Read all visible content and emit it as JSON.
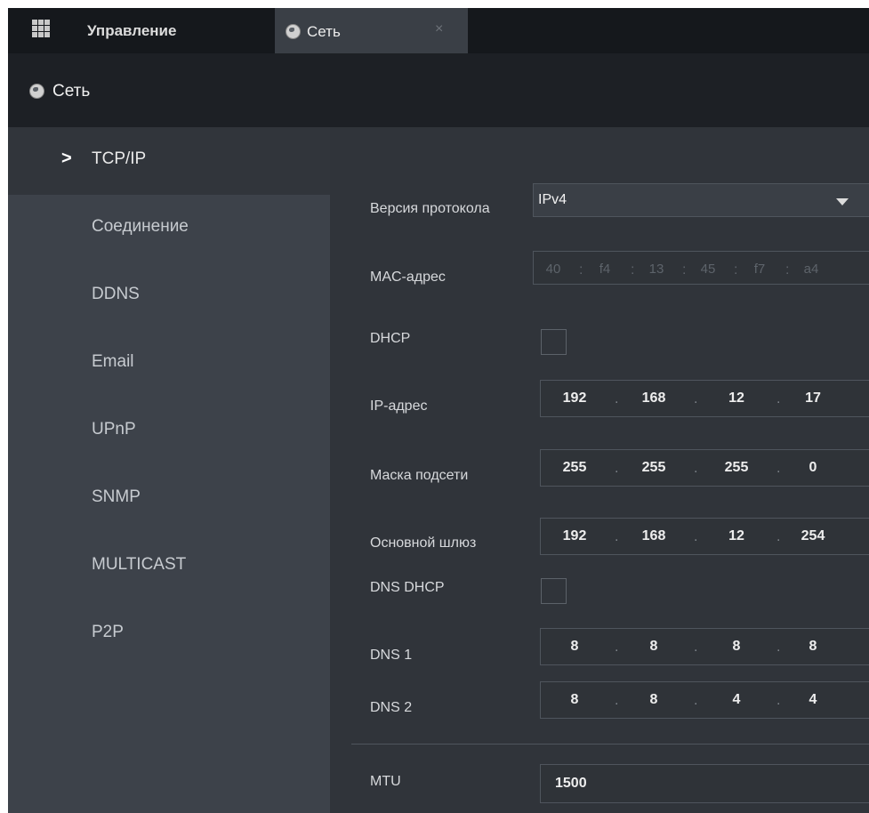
{
  "tabs": {
    "home_label": "Управление",
    "network_label": "Сеть",
    "close_glyph": "×"
  },
  "section": {
    "title": "Сеть"
  },
  "sidebar": {
    "items": [
      {
        "label": "TCP/IP",
        "active": true
      },
      {
        "label": "Соединение"
      },
      {
        "label": "DDNS"
      },
      {
        "label": "Email"
      },
      {
        "label": "UPnP"
      },
      {
        "label": "SNMP"
      },
      {
        "label": "MULTICAST"
      },
      {
        "label": "P2P"
      }
    ],
    "active_marker": ">"
  },
  "form": {
    "protocol_version": {
      "label": "Версия протокола",
      "value": "IPv4"
    },
    "mac": {
      "label": "MAC-адрес",
      "parts": [
        "40",
        "f4",
        "13",
        "45",
        "f7",
        "a4"
      ],
      "separator": ":"
    },
    "dhcp": {
      "label": "DHCP",
      "checked": false
    },
    "ip": {
      "label": "IP-адрес",
      "octets": [
        "192",
        "168",
        "12",
        "17"
      ]
    },
    "mask": {
      "label": "Маска подсети",
      "octets": [
        "255",
        "255",
        "255",
        "0"
      ]
    },
    "gateway": {
      "label": "Основной шлюз",
      "octets": [
        "192",
        "168",
        "12",
        "254"
      ]
    },
    "dns_dhcp": {
      "label": "DNS DHCP",
      "checked": false
    },
    "dns1": {
      "label": "DNS 1",
      "octets": [
        "8",
        "8",
        "8",
        "8"
      ]
    },
    "dns2": {
      "label": "DNS 2",
      "octets": [
        "8",
        "8",
        "4",
        "4"
      ]
    },
    "mtu": {
      "label": "MTU",
      "value": "1500"
    },
    "ip_separator": "."
  },
  "colors": {
    "tabbar": "#15181c",
    "header": "#1d2025",
    "sidebar": "#3d424a",
    "content": "#30343a"
  }
}
